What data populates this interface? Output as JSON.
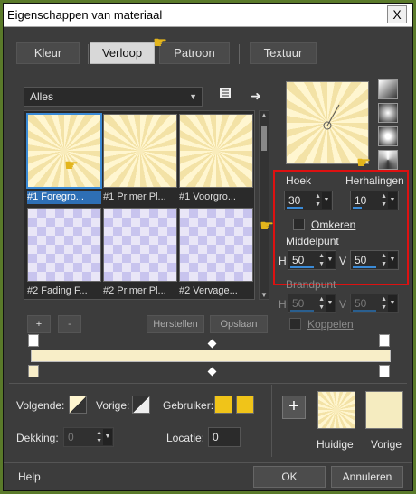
{
  "window": {
    "title": "Eigenschappen van materiaal",
    "close_label": "X"
  },
  "tabs": [
    {
      "label": "Kleur"
    },
    {
      "label": "Verloop"
    },
    {
      "label": "Patroon"
    },
    {
      "label": "Textuur"
    }
  ],
  "active_tab": "Verloop",
  "gallery": {
    "filter_value": "Alles",
    "items": [
      {
        "label": "#1 Foregro..."
      },
      {
        "label": "#1 Primer Pl..."
      },
      {
        "label": "#1 Voorgro..."
      },
      {
        "label": "#2 Fading F..."
      },
      {
        "label": "#2 Primer Pl..."
      },
      {
        "label": "#2 Vervage..."
      }
    ],
    "add_label": "+",
    "remove_label": "-",
    "reset_label": "Herstellen",
    "save_label": "Opslaan"
  },
  "settings": {
    "angle_label": "Hoek",
    "angle_value": "30",
    "repeats_label": "Herhalingen",
    "repeats_value": "10",
    "invert_label": "Omkeren",
    "center_label": "Middelpunt",
    "center_h_label": "H",
    "center_h_value": "50",
    "center_v_label": "V",
    "center_v_value": "50",
    "focal_label": "Brandpunt",
    "focal_h_label": "H",
    "focal_h_value": "50",
    "focal_v_label": "V",
    "focal_v_value": "50",
    "link_label": "Koppelen"
  },
  "bottom": {
    "following_label": "Volgende:",
    "previous_label": "Vorige:",
    "user_label": "Gebruiker:",
    "opacity_label": "Dekking:",
    "opacity_value": "0",
    "location_label": "Locatie:",
    "location_value": "0",
    "add_icon": "+",
    "current_label": "Huidige",
    "previous_swatch_label": "Vorige"
  },
  "footer": {
    "help_label": "Help",
    "ok_label": "OK",
    "cancel_label": "Annuleren"
  },
  "colors": {
    "accent": "#3a8ad6",
    "highlight_box": "#dd1111",
    "gradient_light": "#fff6d0",
    "gradient_dark": "#f3e2a6",
    "user_swatch": "#f0c419"
  }
}
